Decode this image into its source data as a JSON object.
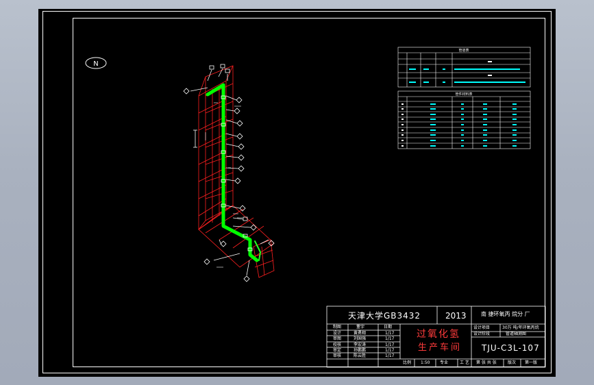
{
  "title_block": {
    "school": "天津大学GB3432",
    "year": "2013",
    "plant": "南 捷环氧丙 烷分 厂",
    "name_line1": "过氧化氢",
    "name_line2": "生产车间",
    "drawing_no": "TJU-C3L-107",
    "project_row1": "30万 吨/年环氧丙烷",
    "project_row2": "管道轴测图",
    "label_design": "设计项目",
    "label_stage": "设计阶段",
    "roles": [
      "制图",
      "设计",
      "审图",
      "校核",
      "审定",
      "审核"
    ],
    "people": [
      "董宇",
      "黄勇翔",
      "刘国强",
      "李宏涛",
      "孙鹏鹏",
      "陈云胜"
    ],
    "date_header": "日期",
    "dates": [
      "",
      "1/17",
      "1/17",
      "1/17",
      "1/17",
      "1/17"
    ],
    "bottom_cells": [
      "比例",
      "1:50",
      "专业",
      "工 艺",
      "第 张 共 张",
      "版次",
      "第一版"
    ]
  },
  "tables": {
    "table1_title": "管道表",
    "table2_title": "管件材料表"
  },
  "north_arrow": "N",
  "colors": {
    "pipe": "#00ff00",
    "steel": "#ff2020",
    "annotation": "#ffffff",
    "table_text": "#00ffff",
    "background": "#000000"
  }
}
